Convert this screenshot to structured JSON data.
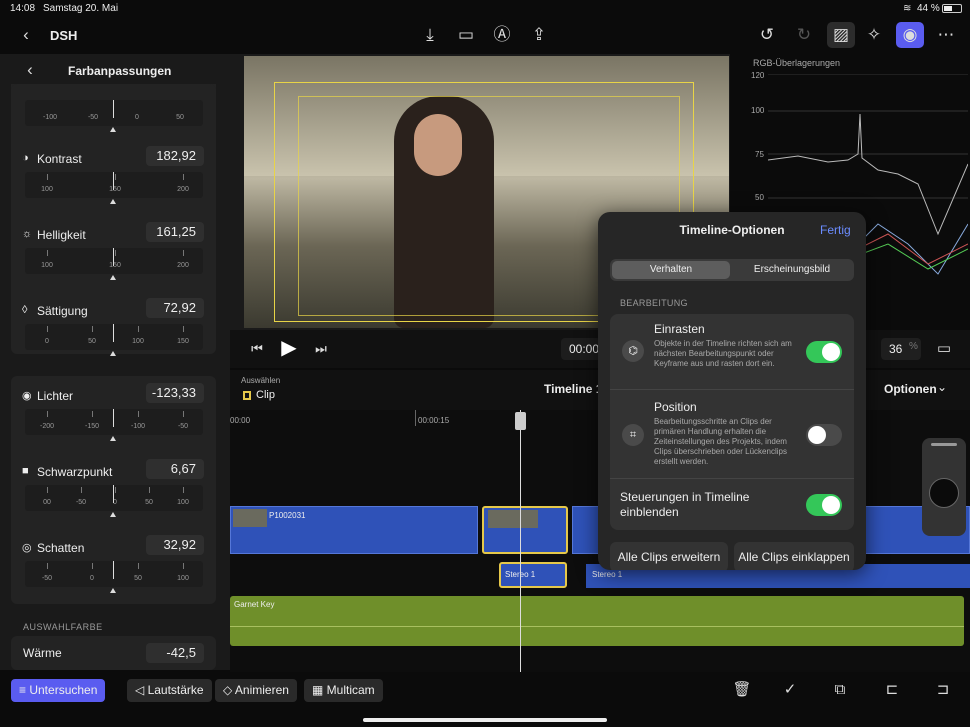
{
  "status": {
    "time": "14:08",
    "date": "Samstag 20. Mai",
    "battery": "44 %"
  },
  "topbar": {
    "back_icon": "chevron-left-icon",
    "project": "DSH"
  },
  "left_panel": {
    "title": "Farbanpassungen",
    "section_selection_color": "AUSWAHLFARBE",
    "params": [
      {
        "label": "Kontrast",
        "value": "182,92",
        "ticks": [
          "100",
          "150",
          "200"
        ]
      },
      {
        "label": "Helligkeit",
        "value": "161,25",
        "ticks": [
          "100",
          "150",
          "200"
        ]
      },
      {
        "label": "Sättigung",
        "value": "72,92",
        "ticks": [
          "0",
          "50",
          "100",
          "150"
        ]
      },
      {
        "label": "Lichter",
        "value": "-123,33",
        "ticks": [
          "-200",
          "-150",
          "-100",
          "-50"
        ]
      },
      {
        "label": "Schwarzpunkt",
        "value": "6,67",
        "ticks": [
          "00",
          "-50",
          "0",
          "50",
          "100"
        ]
      },
      {
        "label": "Schatten",
        "value": "32,92",
        "ticks": [
          "-50",
          "0",
          "50",
          "100"
        ]
      },
      {
        "label": "Wärme",
        "value": "-42,5"
      }
    ],
    "top_ruler_ticks": [
      "-100",
      "-50",
      "0",
      "50"
    ]
  },
  "scope": {
    "title": "RGB-Überlagerungen",
    "ticks": [
      "120",
      "100",
      "75",
      "50"
    ]
  },
  "transport": {
    "timecode": "00:00",
    "zoom": "36",
    "zoom_unit": "%"
  },
  "timeline": {
    "select_label": "Auswählen",
    "select_value": "Clip",
    "name": "Timeline 1",
    "options": "Optionen",
    "ruler": [
      "00:00",
      "00:00:15"
    ],
    "clip_main": "P1002031",
    "audio_1": "Stereo 1",
    "audio_2": "Stereo 1",
    "garnet": "Garnet Key"
  },
  "popover": {
    "title": "Timeline-Optionen",
    "done": "Fertig",
    "tab_1": "Verhalten",
    "tab_2": "Erscheinungsbild",
    "section": "BEARBEITUNG",
    "snap_title": "Einrasten",
    "snap_desc": "Objekte in der Timeline richten sich am nächsten Bearbeitungspunkt oder Keyframe aus und rasten dort ein.",
    "snap_on": true,
    "position_title": "Position",
    "position_desc": "Bearbeitungsschritte an Clips der primären Handlung erhalten die Zeiteinstellungen des Projekts, indem Clips überschrieben oder Lückenclips erstellt werden.",
    "position_on": false,
    "controls_title": "Steuerungen in Timeline einblenden",
    "controls_on": true,
    "expand_all": "Alle Clips erweitern",
    "collapse_all": "Alle Clips einklappen"
  },
  "bottom": {
    "inspect": "Untersuchen",
    "volume": "Lautstärke",
    "animate": "Animieren",
    "multicam": "Multicam"
  },
  "colors": {
    "accent": "#5a5cf0",
    "toggle_on": "#34c759",
    "clip_blue": "#2f52b8",
    "clip_green": "#6f8f2a",
    "selection": "#e5c84a"
  }
}
